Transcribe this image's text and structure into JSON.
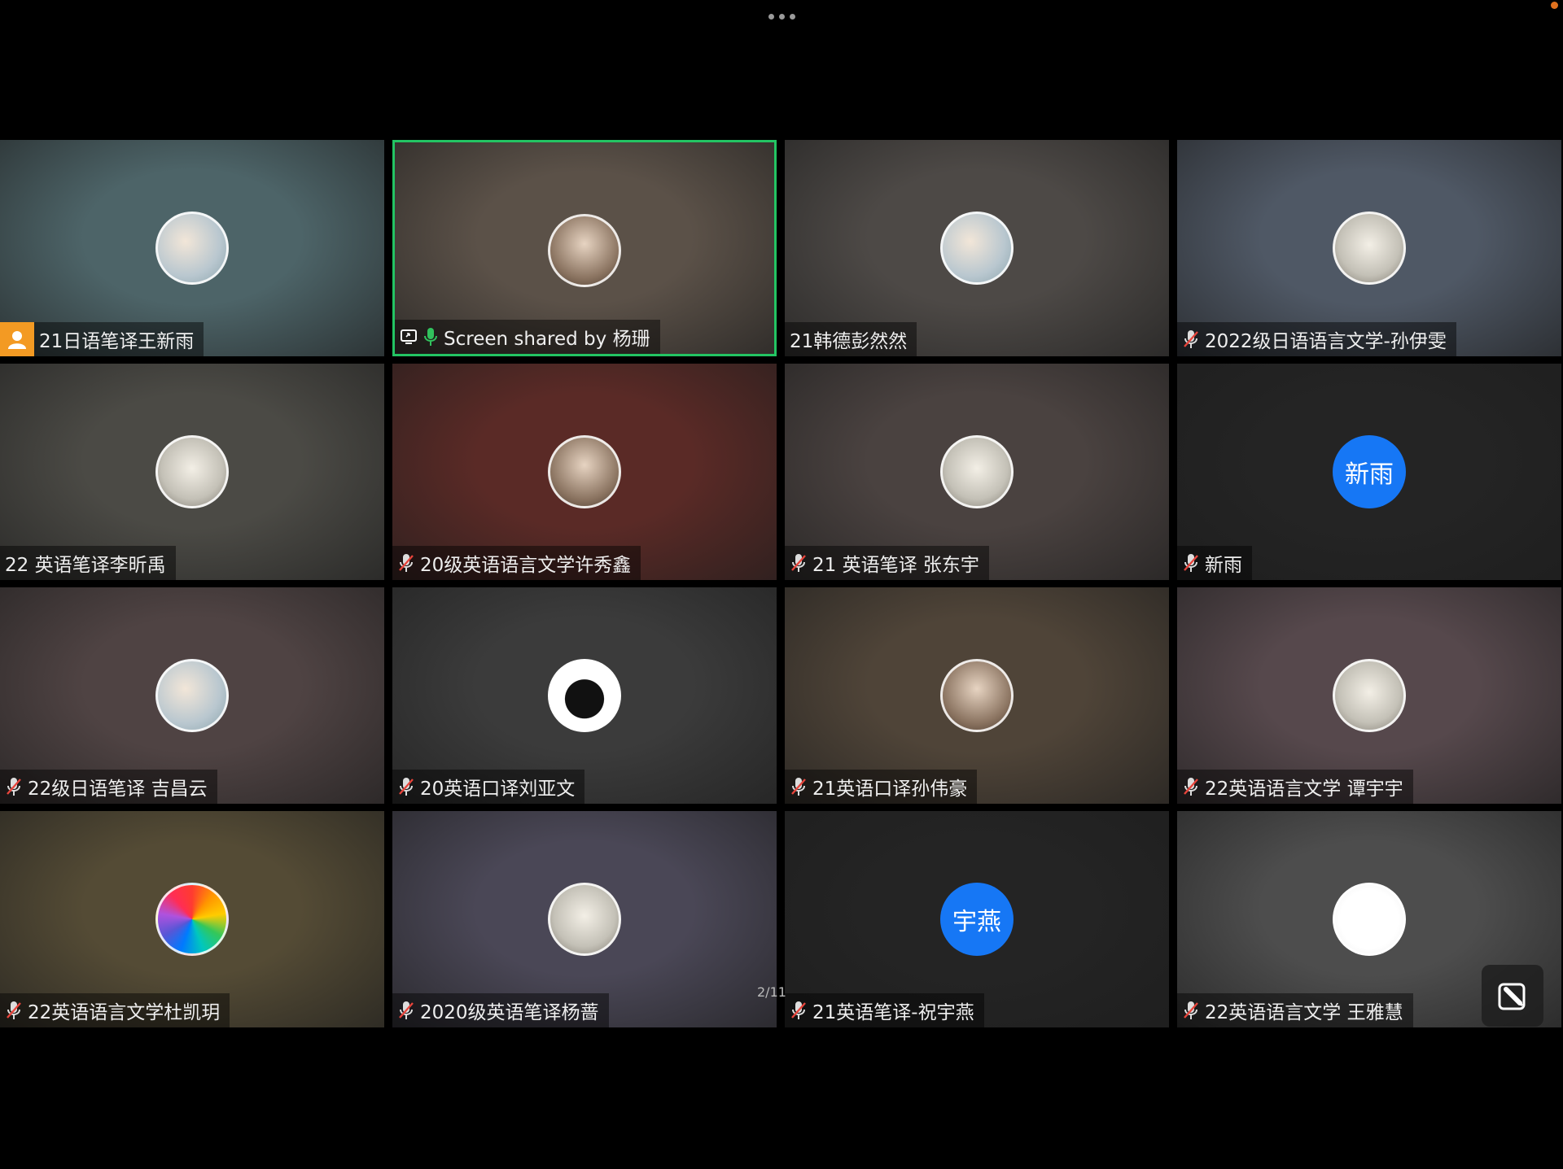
{
  "page_indicator": "2/11",
  "tiles": [
    {
      "name": "21日语笔译王新雨",
      "avatar": "illustration-avatar",
      "bg": "#4d6468",
      "host": true
    },
    {
      "name": "Screen shared by 杨珊",
      "avatar": "photo-avatar",
      "bg": "#5b5148",
      "active": true,
      "sharing": true
    },
    {
      "name": "21韩德彭然然",
      "avatar": "illustration-avatar",
      "bg": "#4d4946"
    },
    {
      "name": "2022级日语语言文学-孙伊雯",
      "avatar": "cartoon-avatar",
      "bg": "#4f5865",
      "muted": true
    },
    {
      "name": "22 英语笔译李昕禹",
      "avatar": "cartoon-avatar",
      "bg": "#4b4a45"
    },
    {
      "name": "20级英语语言文学许秀鑫",
      "avatar": "photo-avatar",
      "bg": "#5a2a26",
      "muted": true
    },
    {
      "name": "21 英语笔译 张东宇",
      "avatar": "cartoon-avatar",
      "bg": "#4a4240",
      "muted": true
    },
    {
      "name": "新雨",
      "avatar_text": "新雨",
      "bg": "#242424",
      "muted": true
    },
    {
      "name": "22级日语笔译 吉昌云",
      "avatar": "illustration-avatar",
      "bg": "#4f4343",
      "muted": true
    },
    {
      "name": "20英语口译刘亚文",
      "avatar": "cat-avatar",
      "bg": "#3b3b3b",
      "muted": true
    },
    {
      "name": "21英语口译孙伟豪",
      "avatar": "photo-avatar",
      "bg": "#4f4438",
      "muted": true
    },
    {
      "name": "22英语语言文学 谭宇宇",
      "avatar": "cartoon-avatar",
      "bg": "#56484c",
      "muted": true
    },
    {
      "name": "22英语语言文学杜凯玥",
      "avatar": "color-wheel-avatar",
      "bg": "#544b35",
      "muted": true
    },
    {
      "name": "2020级英语笔译杨蔷",
      "avatar": "cartoon-avatar",
      "bg": "#4a4756",
      "muted": true
    },
    {
      "name": "21英语笔译-祝宇燕",
      "avatar_text": "宇燕",
      "bg": "#242424",
      "muted": true
    },
    {
      "name": "22英语语言文学 王雅慧",
      "avatar": "sketch-avatar",
      "bg": "#4d4d4d",
      "muted": true
    }
  ]
}
